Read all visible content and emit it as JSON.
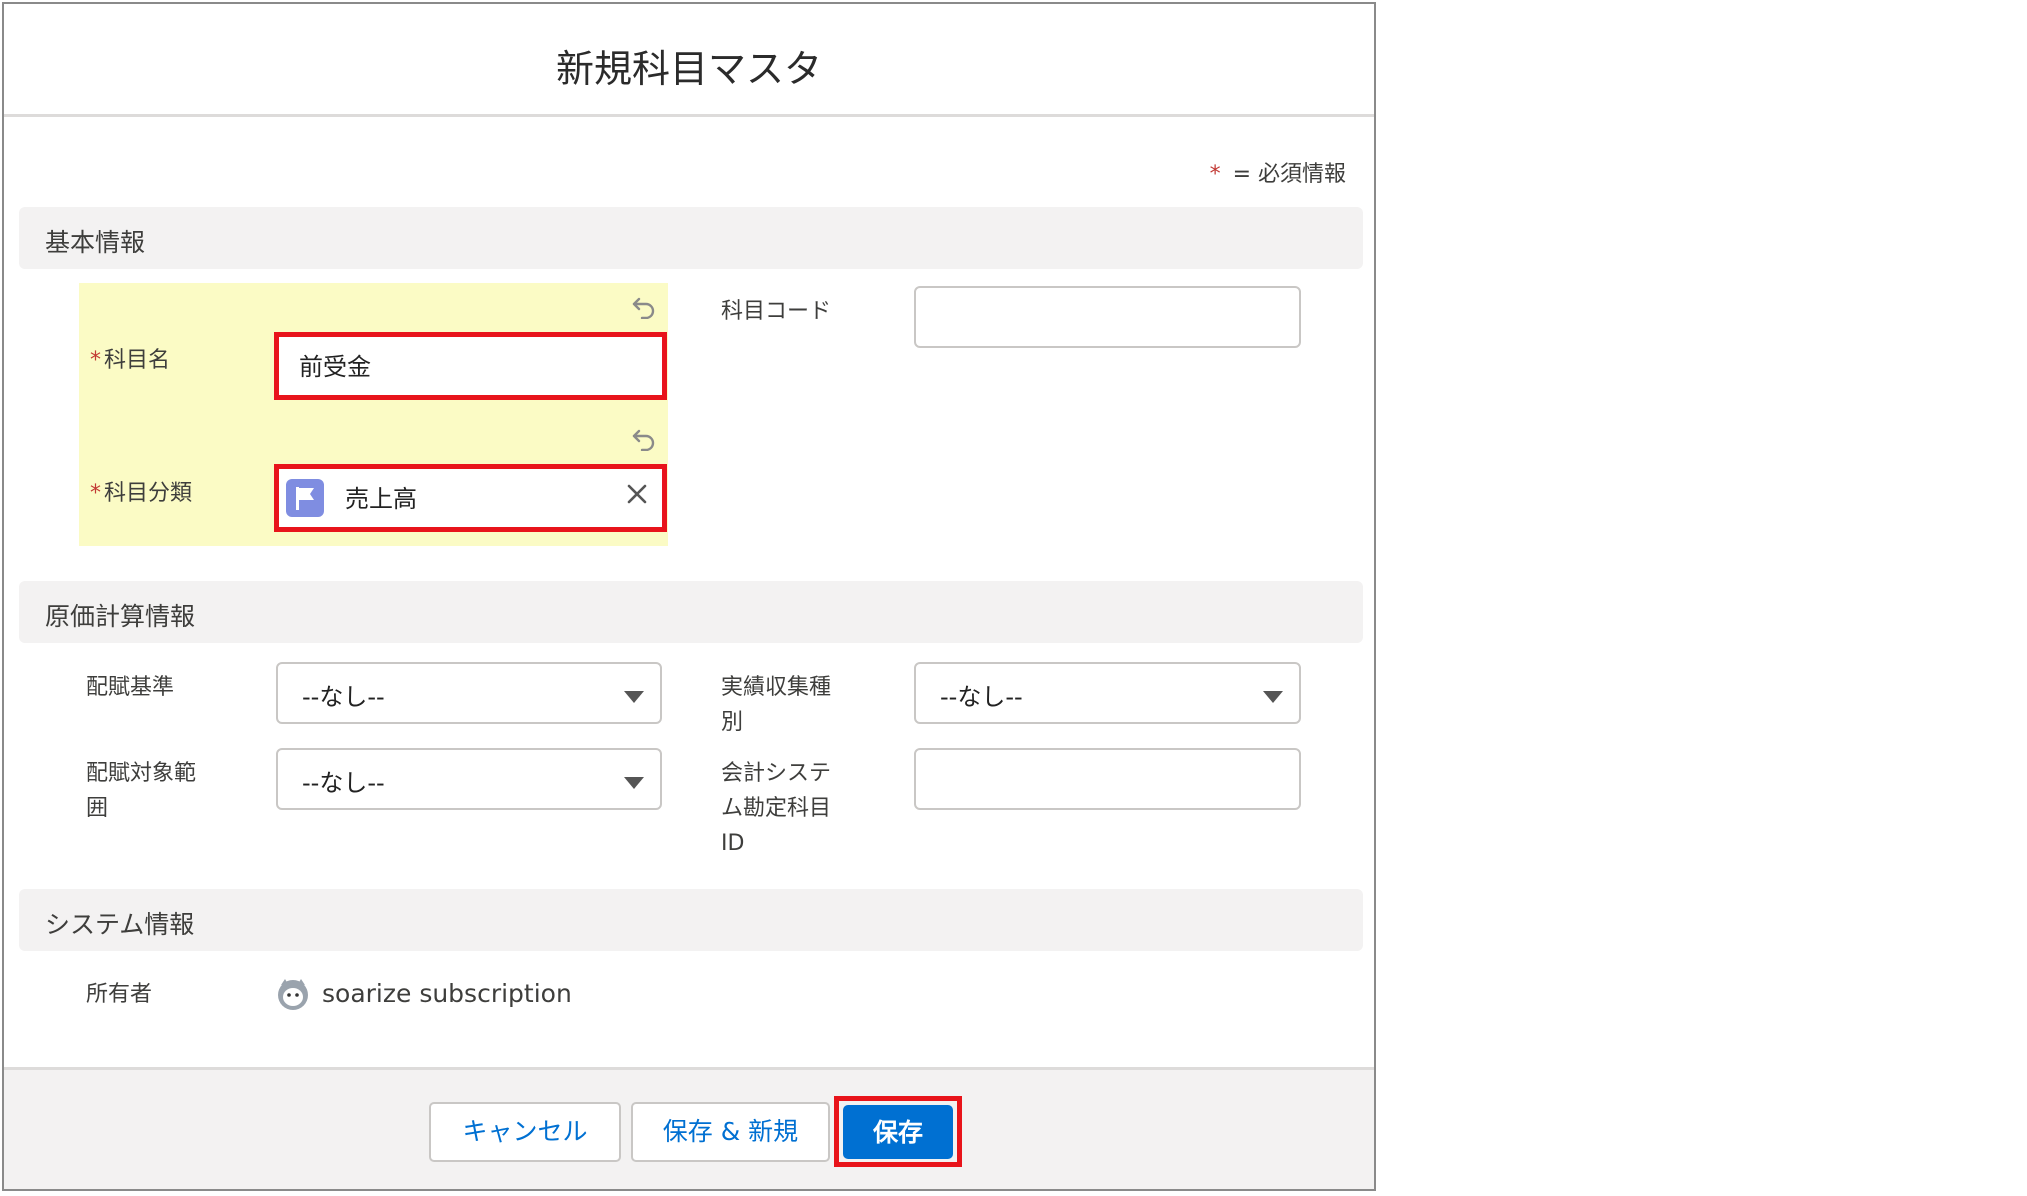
{
  "modal": {
    "title": "新規科目マスタ",
    "required_legend_star": "*",
    "required_legend_text": "= 必須情報"
  },
  "sections": {
    "basic": "基本情報",
    "costing": "原価計算情報",
    "system": "システム情報"
  },
  "basic": {
    "subject_name": {
      "label": "科目名",
      "value": "前受金",
      "required_star": "*"
    },
    "subject_category": {
      "label": "科目分類",
      "value": "売上高",
      "required_star": "*"
    },
    "subject_code": {
      "label": "科目コード",
      "value": ""
    }
  },
  "costing": {
    "allocation_basis": {
      "label_line1": "配賦基準",
      "value": "--なし--"
    },
    "actual_collection_type": {
      "label_line1": "実績収集種",
      "label_line2": "別",
      "value": "--なし--"
    },
    "allocation_scope": {
      "label_line1": "配賦対象範",
      "label_line2": "囲",
      "value": "--なし--"
    },
    "accounting_system_id": {
      "label_line1": "会計システ",
      "label_line2": "ム勘定科目",
      "label_line3": "ID",
      "value": ""
    }
  },
  "system": {
    "owner_label": "所有者",
    "owner_name": "soarize subscription"
  },
  "footer": {
    "cancel": "キャンセル",
    "save_and_new": "保存 & 新規",
    "save": "保存"
  },
  "colors": {
    "primary": "#0070d2",
    "required": "#c23934",
    "highlight": "#fbfbc5",
    "annotation": "#e8141b"
  }
}
